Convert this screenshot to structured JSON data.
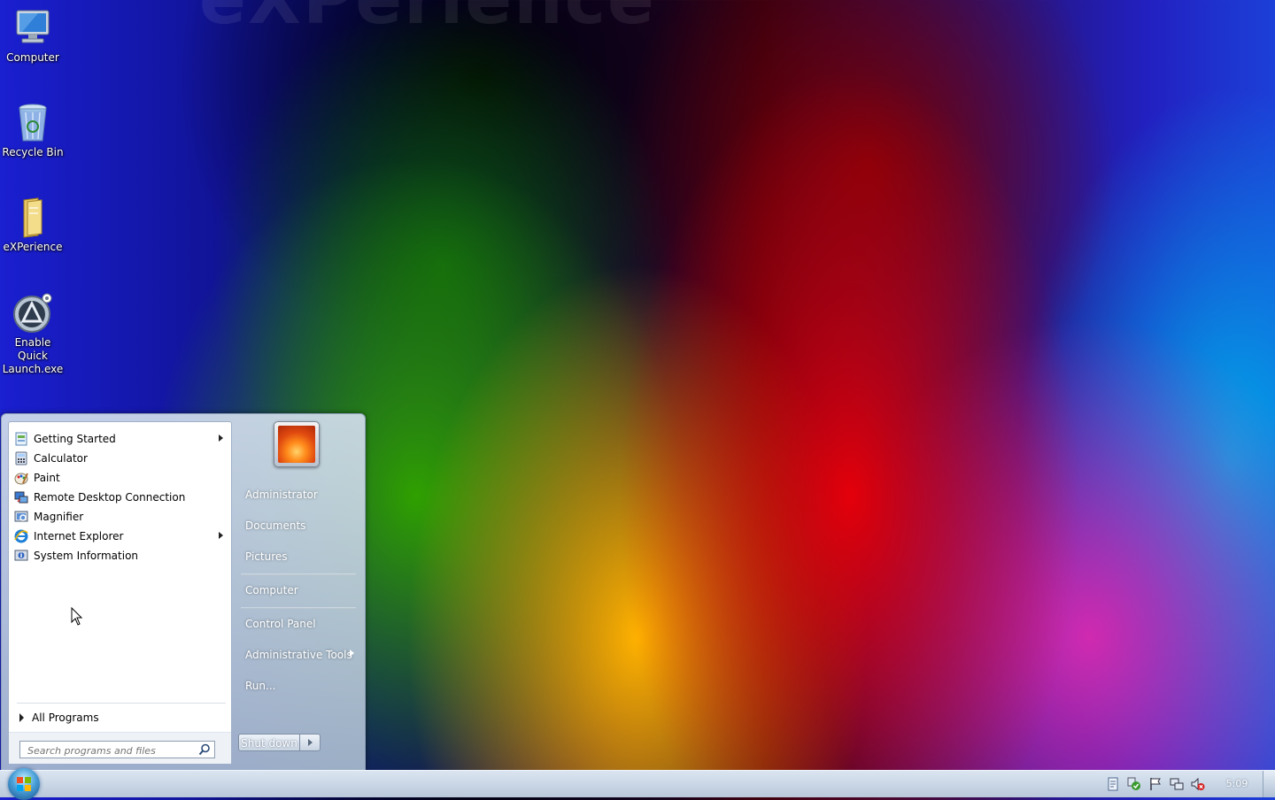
{
  "wallpaper": {
    "watermark": "eXPerience"
  },
  "desktop_icons": [
    {
      "label": "Computer",
      "icon": "computer-icon"
    },
    {
      "label": "Recycle Bin",
      "icon": "recycle-bin-icon"
    },
    {
      "label": "eXPerience",
      "icon": "folder-icon"
    },
    {
      "label": "Enable Quick Launch.exe",
      "icon": "quick-launch-icon"
    }
  ],
  "start_menu": {
    "programs": [
      {
        "label": "Getting Started",
        "icon": "getting-started-icon",
        "has_submenu": true
      },
      {
        "label": "Calculator",
        "icon": "calculator-icon",
        "has_submenu": false
      },
      {
        "label": "Paint",
        "icon": "paint-icon",
        "has_submenu": false
      },
      {
        "label": "Remote Desktop Connection",
        "icon": "remote-desktop-icon",
        "has_submenu": false
      },
      {
        "label": "Magnifier",
        "icon": "magnifier-icon",
        "has_submenu": false
      },
      {
        "label": "Internet Explorer",
        "icon": "internet-explorer-icon",
        "has_submenu": true
      },
      {
        "label": "System Information",
        "icon": "system-information-icon",
        "has_submenu": false
      }
    ],
    "all_programs": "All Programs",
    "search": {
      "placeholder": "Search programs and files"
    },
    "right_links": [
      {
        "label": "Administrator"
      },
      {
        "label": "Documents"
      },
      {
        "label": "Pictures"
      },
      {
        "label": "Computer"
      },
      {
        "label": "Control Panel"
      },
      {
        "label": "Administrative Tools",
        "has_submenu": true
      },
      {
        "label": "Run..."
      }
    ],
    "shutdown_label": "Shut down"
  },
  "taskbar": {
    "clock": "5:09",
    "tray_icons": [
      "action-center-icon",
      "security-shield-icon",
      "flag-icon",
      "network-icon",
      "volume-muted-icon"
    ]
  }
}
